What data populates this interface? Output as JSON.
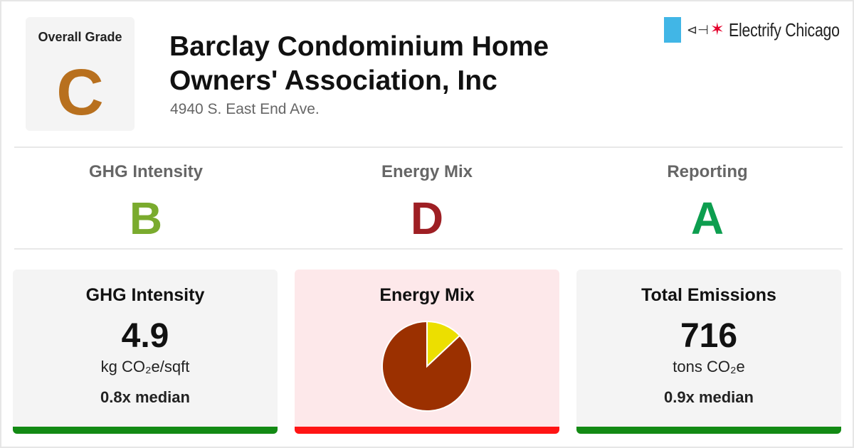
{
  "overall": {
    "label": "Overall Grade",
    "grade": "C",
    "color": "#b8701e"
  },
  "building": {
    "name": "Barclay Condominium Home Owners' Association, Inc",
    "address": "4940 S. East End Ave."
  },
  "brand": {
    "name": "Electrify Chicago",
    "flag_color": "#41b6e6",
    "star_color": "#e4002b",
    "icons": [
      "flag-icon",
      "plug-icon",
      "star-icon"
    ]
  },
  "grades": [
    {
      "label": "GHG Intensity",
      "grade": "B",
      "color": "#7aab2e"
    },
    {
      "label": "Energy Mix",
      "grade": "D",
      "color": "#9e1f24"
    },
    {
      "label": "Reporting",
      "grade": "A",
      "color": "#0d9e4f"
    }
  ],
  "panels": {
    "ghg": {
      "title": "GHG Intensity",
      "value": "4.9",
      "unit": "kg CO₂e/sqft",
      "median": "0.8x median",
      "bar_color": "#138a14"
    },
    "mix": {
      "title": "Energy Mix",
      "bar_color": "#ff1414"
    },
    "emissions": {
      "title": "Total Emissions",
      "value": "716",
      "unit": "tons CO₂e",
      "median": "0.9x median",
      "bar_color": "#138a14"
    }
  },
  "chart_data": {
    "type": "pie",
    "slices": [
      {
        "value": 87,
        "color": "#9b3000"
      },
      {
        "value": 13,
        "color": "#ecdf00"
      }
    ]
  }
}
